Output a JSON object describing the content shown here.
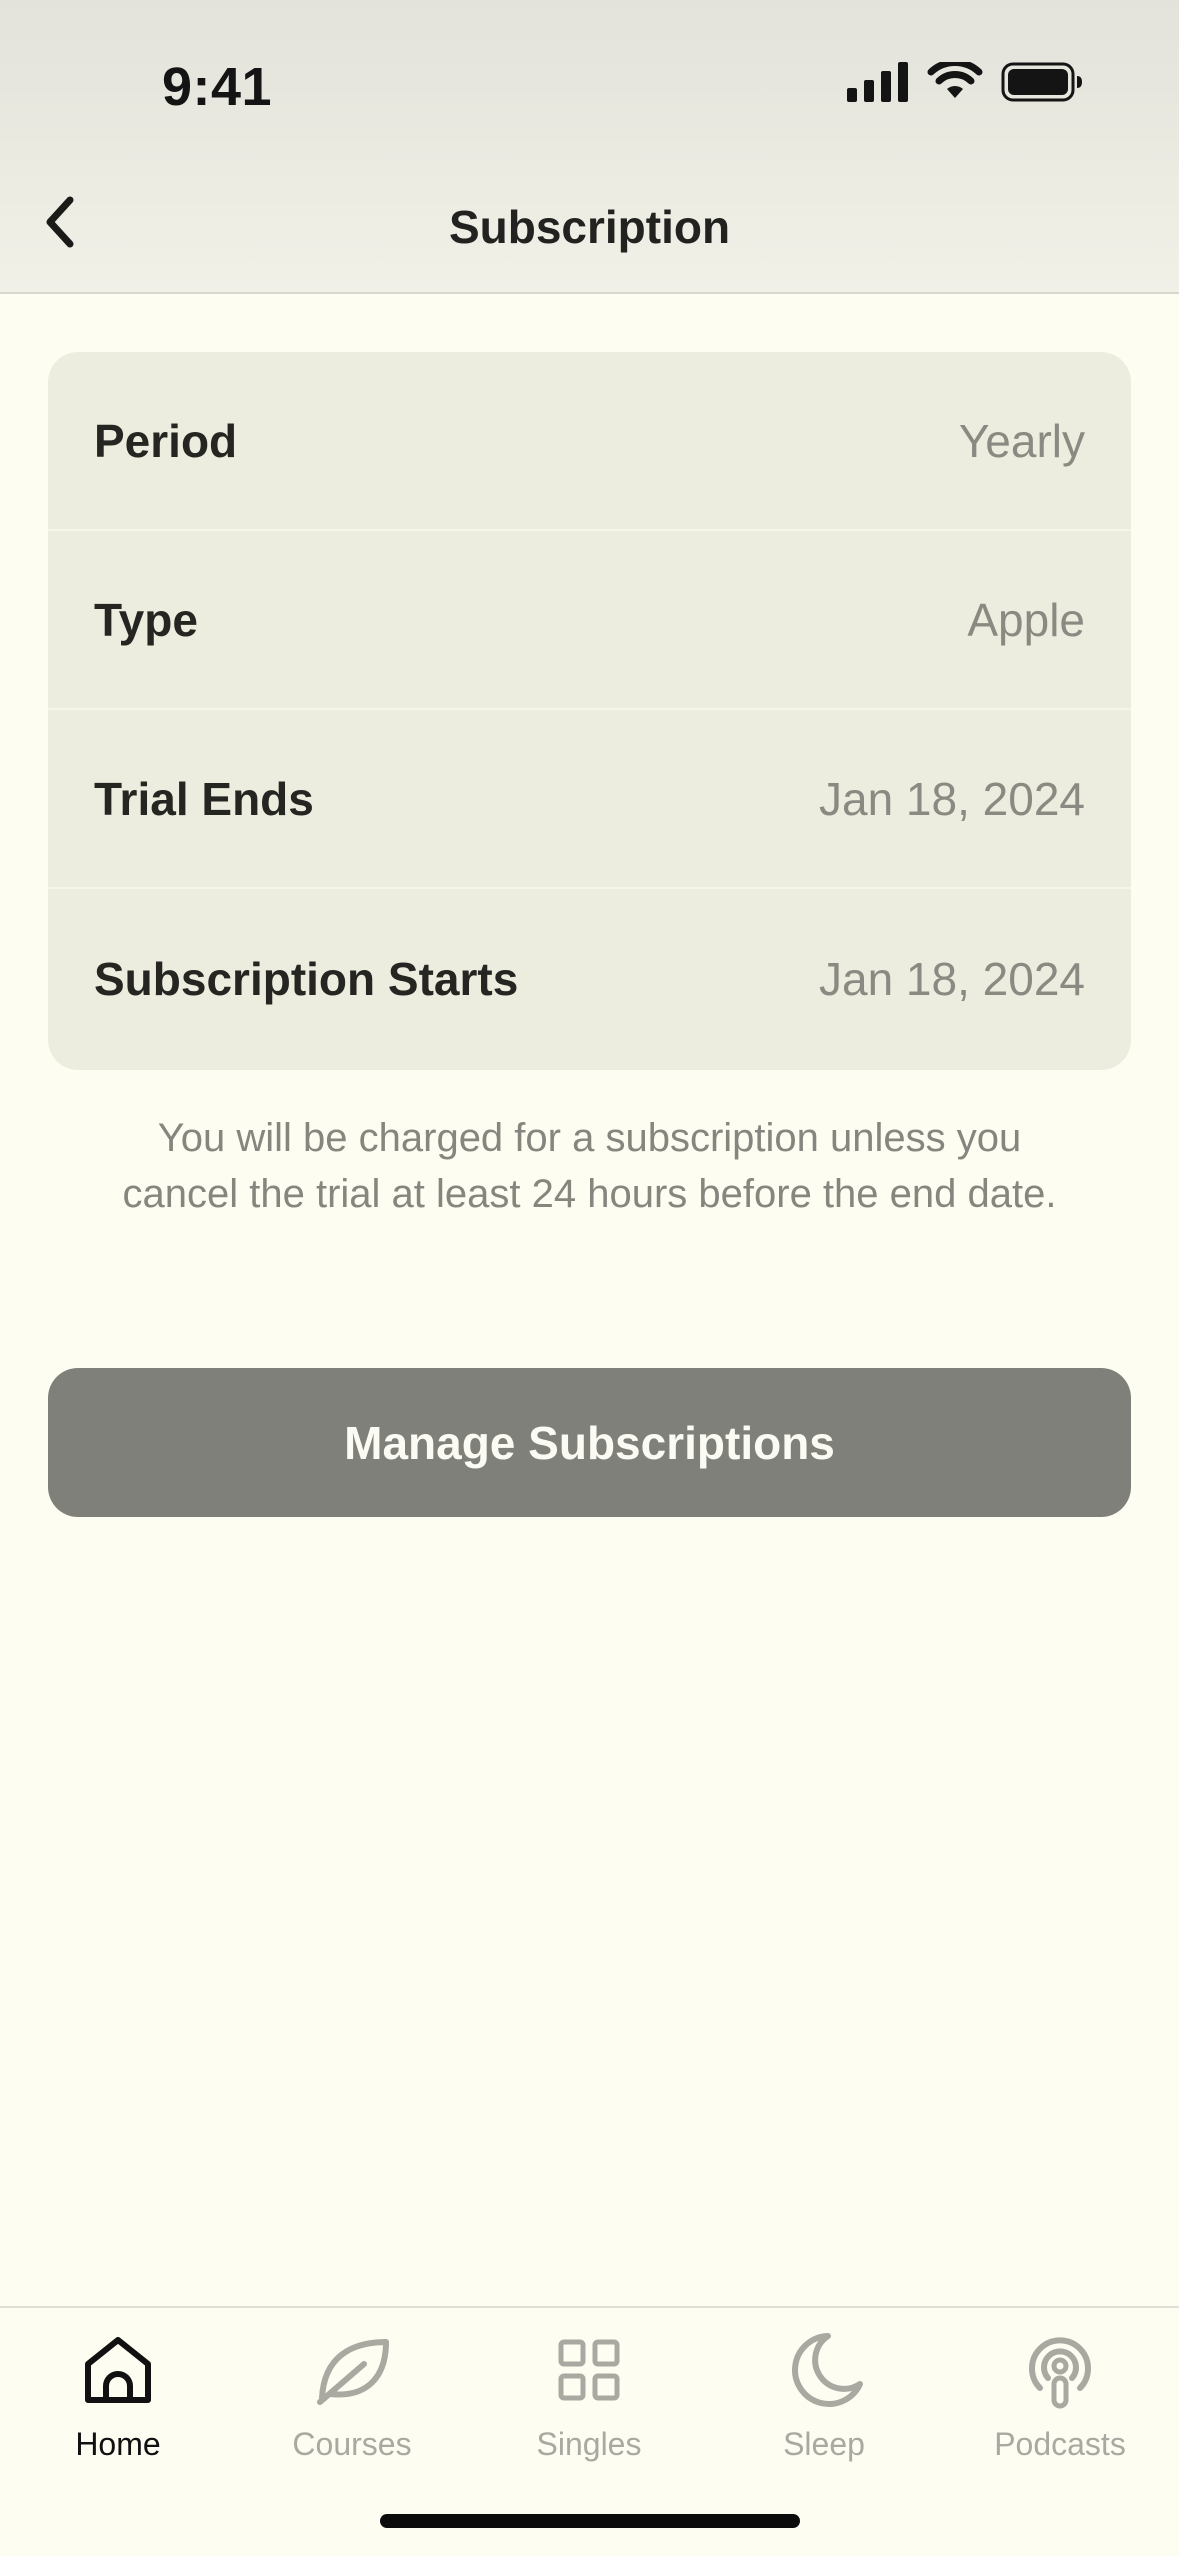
{
  "status_bar": {
    "time": "9:41"
  },
  "nav": {
    "title": "Subscription"
  },
  "details": [
    {
      "label": "Period",
      "value": "Yearly"
    },
    {
      "label": "Type",
      "value": "Apple"
    },
    {
      "label": "Trial Ends",
      "value": "Jan 18, 2024"
    },
    {
      "label": "Subscription Starts",
      "value": "Jan 18, 2024"
    }
  ],
  "notice": "You will be charged for a subscription unless you cancel the trial at least 24 hours before the end date.",
  "manage_button": {
    "label": "Manage Subscriptions"
  },
  "tabs": [
    {
      "label": "Home",
      "icon": "home-icon",
      "active": true
    },
    {
      "label": "Courses",
      "icon": "leaf-icon",
      "active": false
    },
    {
      "label": "Singles",
      "icon": "grid-icon",
      "active": false
    },
    {
      "label": "Sleep",
      "icon": "moon-icon",
      "active": false
    },
    {
      "label": "Podcasts",
      "icon": "podcast-icon",
      "active": false
    }
  ],
  "colors": {
    "background": "#fdfdf1",
    "card": "#ededdf",
    "button": "#80807b",
    "muted_text": "#8a8a82"
  }
}
